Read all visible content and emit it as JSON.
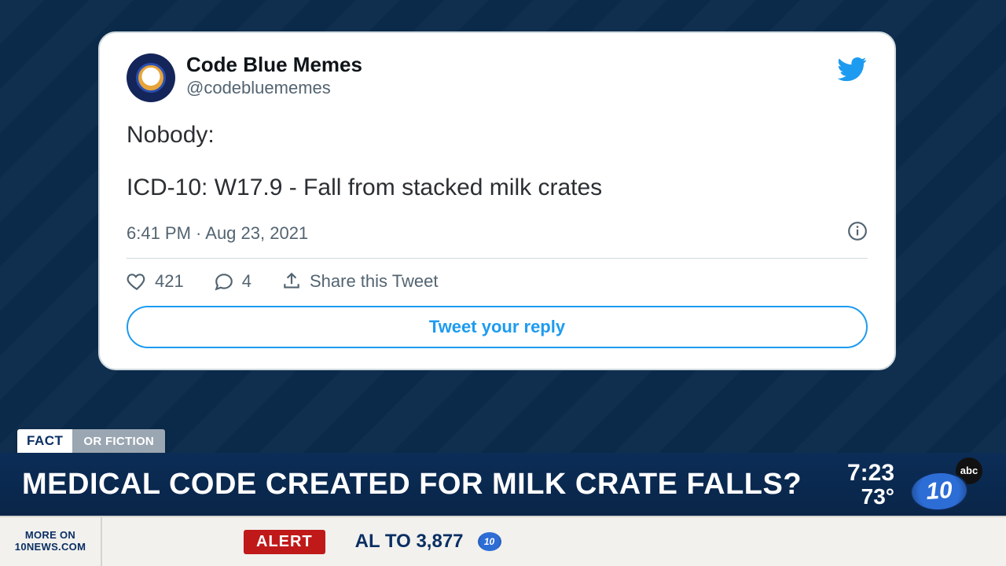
{
  "tweet": {
    "display_name": "Code Blue Memes",
    "handle": "@codebluememes",
    "lines": [
      "Nobody:",
      "ICD-10: W17.9 - Fall from stacked milk crates"
    ],
    "timestamp": "6:41 PM · Aug 23, 2021",
    "likes": "421",
    "replies": "4",
    "share_label": "Share this Tweet",
    "reply_button": "Tweet your reply"
  },
  "segment": {
    "fact_label": "FACT",
    "fiction_label": "OR FICTION"
  },
  "chyron": {
    "headline": "MEDICAL CODE CREATED FOR MILK CRATE FALLS?",
    "clock": "7:23",
    "temp": "73°",
    "abc": "abc",
    "station_number": "10"
  },
  "ticker": {
    "more_on_line1": "MORE ON",
    "more_on_line2": "10NEWS.COM",
    "alert_label": "ALERT",
    "text": "AL TO 3,877",
    "mini_logo": "10"
  }
}
